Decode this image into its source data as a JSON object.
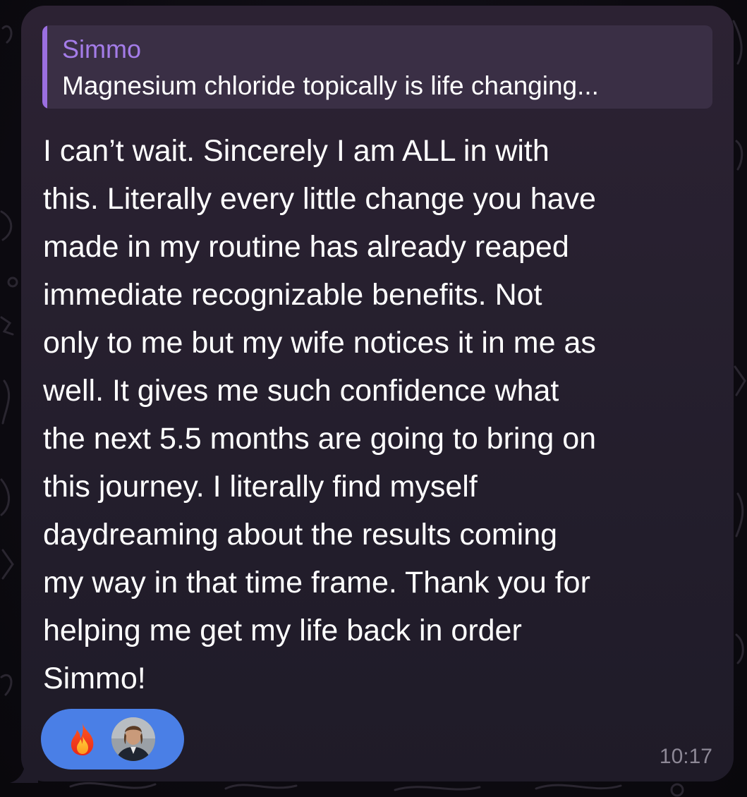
{
  "reply": {
    "author": "Simmo",
    "preview": "Magnesium chloride topically is life changing..."
  },
  "message": {
    "lines": [
      "I can’t wait. Sincerely I am ALL in with",
      "this. Literally every little change you have",
      "made in my routine has already reaped",
      "immediate recognizable benefits. Not",
      "only to me but my wife notices it in me as",
      "well. It gives me such confidence what",
      "the next 5.5 months are going to bring on",
      "this journey. I literally find myself",
      "daydreaming about the results coming",
      "my way in that time frame. Thank you for",
      "helping me get my life back in order",
      "Simmo!"
    ]
  },
  "reactions": {
    "emoji_icon": "fire-icon",
    "reactor_avatar": "avatar"
  },
  "timestamp": "10:17",
  "colors": {
    "reply_accent": "#9b6fe0",
    "reply_name": "#a47ce8",
    "reaction_pill": "#4a7fe6",
    "bubble": "#27202f"
  }
}
